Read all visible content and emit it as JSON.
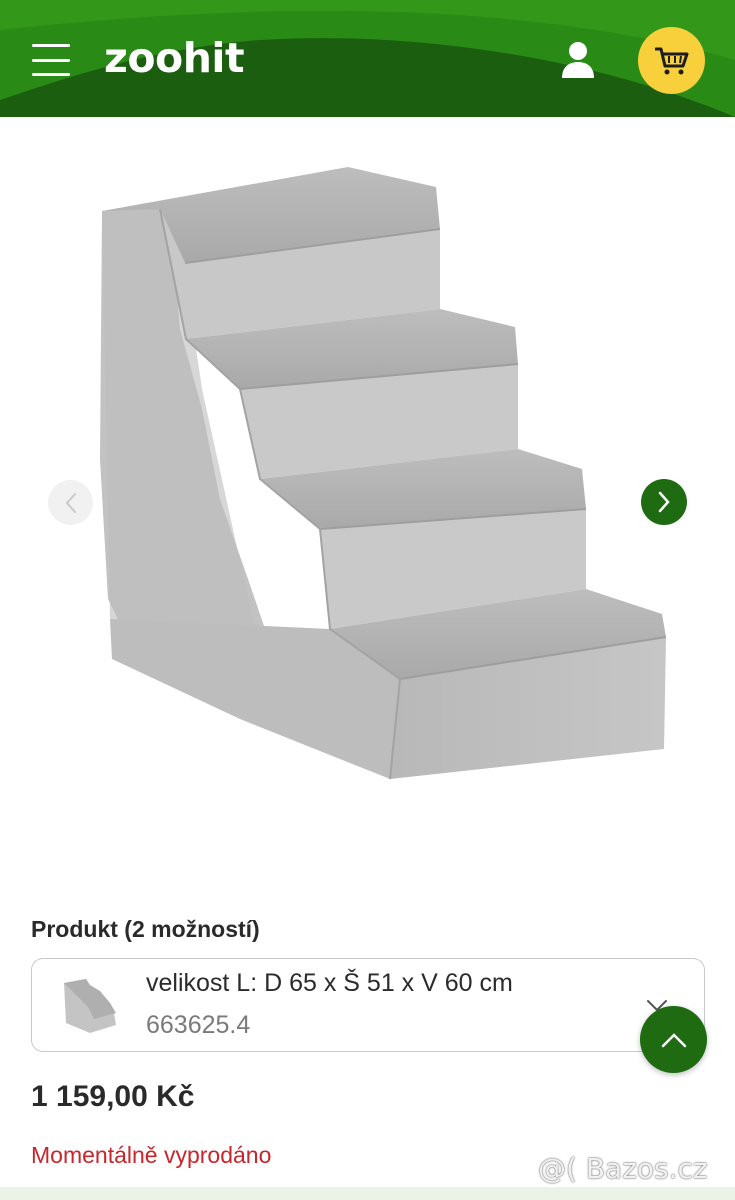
{
  "header": {
    "logo": "zoohit",
    "menu_icon": "hamburger-menu-icon",
    "user_icon": "user-icon",
    "cart_icon": "cart-icon"
  },
  "colors": {
    "brand_green": "#1e6b12",
    "cart_yellow": "#f7d03b",
    "sold_out_red": "#c8252c"
  },
  "gallery": {
    "image": "pet-stairs-4-step-grey-plush",
    "prev_icon": "chevron-left-icon",
    "next_icon": "chevron-right-icon"
  },
  "product": {
    "options_title": "Produkt (2 možností)",
    "selected_variant": {
      "name": "velikost L: D 65 x Š 51 x V 60 cm",
      "code": "663625.4"
    },
    "price": "1 159,00 Kč",
    "stock_status": "Momentálně vyprodáno"
  },
  "watermark": "@( Bazos.cz",
  "scroll_top_icon": "chevron-up-icon"
}
